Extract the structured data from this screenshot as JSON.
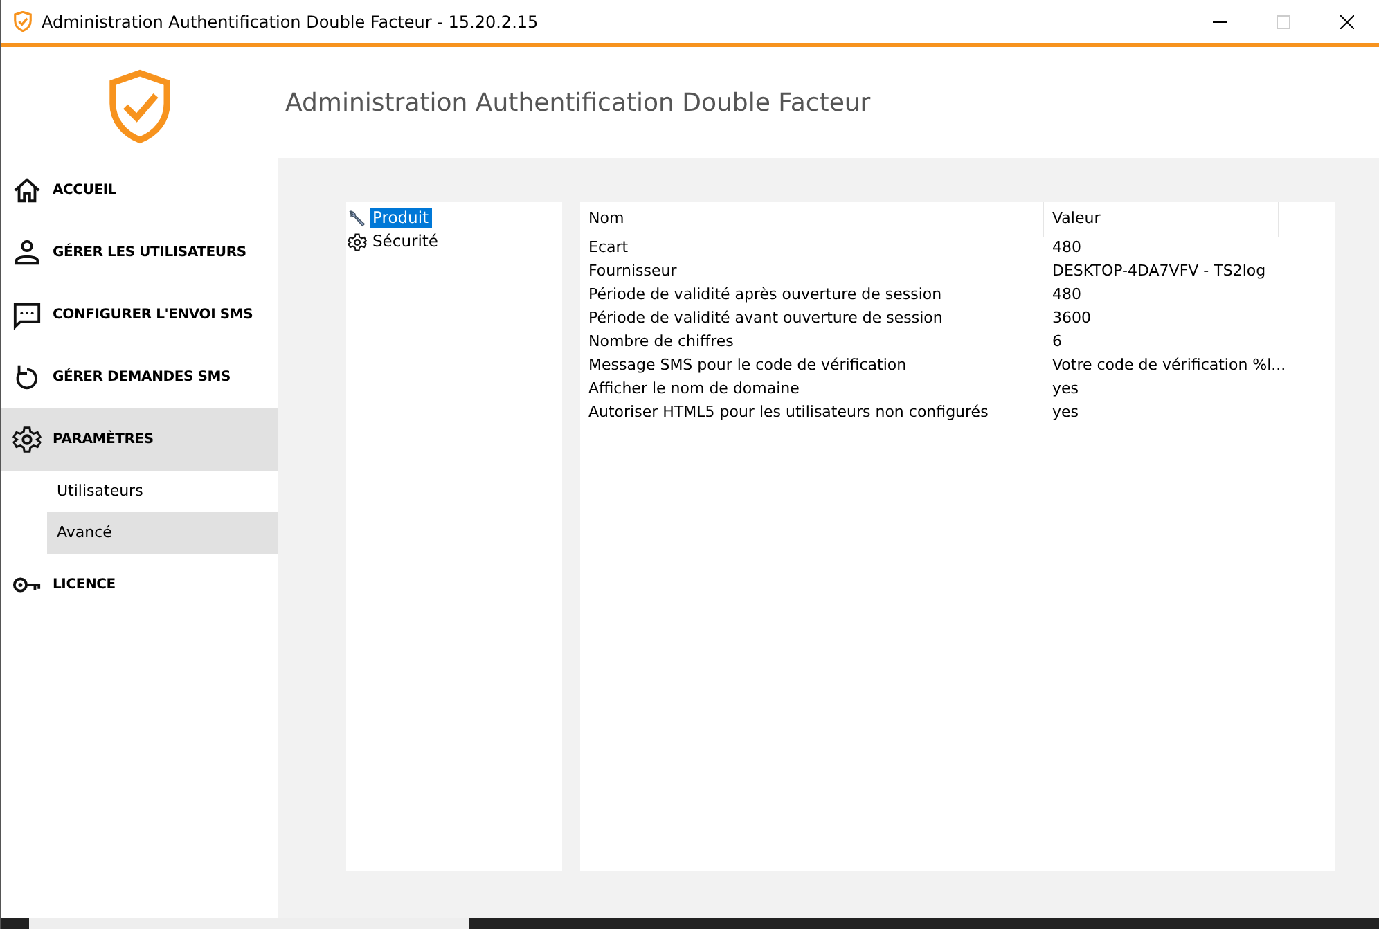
{
  "window": {
    "title": "Administration Authentification Double Facteur - 15.20.2.15"
  },
  "header": {
    "title": "Administration Authentification Double Facteur"
  },
  "sidebar": {
    "items": [
      {
        "label": "ACCUEIL",
        "kind": "main",
        "selected": false
      },
      {
        "label": "GÉRER LES UTILISATEURS",
        "kind": "main",
        "selected": false
      },
      {
        "label": "CONFIGURER L'ENVOI SMS",
        "kind": "main",
        "selected": false
      },
      {
        "label": "GÉRER DEMANDES SMS",
        "kind": "main",
        "selected": false
      },
      {
        "label": "PARAMÈTRES",
        "kind": "main",
        "selected": true
      },
      {
        "label": "Utilisateurs",
        "kind": "sub",
        "selected": false
      },
      {
        "label": "Avancé",
        "kind": "sub",
        "selected": true
      },
      {
        "label": "LICENCE",
        "kind": "main",
        "selected": false
      }
    ]
  },
  "tree": {
    "items": [
      {
        "label": "Produit",
        "selected": true
      },
      {
        "label": "Sécurité",
        "selected": false
      }
    ]
  },
  "table": {
    "columns": [
      "Nom",
      "Valeur"
    ],
    "rows": [
      [
        "Ecart",
        "480"
      ],
      [
        "Fournisseur",
        "DESKTOP-4DA7VFV - TS2log"
      ],
      [
        "Période de validité après ouverture de session",
        "480"
      ],
      [
        "Période de validité avant ouverture de session",
        "3600"
      ],
      [
        "Nombre de chiffres",
        "6"
      ],
      [
        "Message SMS pour le code de vérification",
        "Votre code de vérification %l..."
      ],
      [
        "Afficher le nom de domaine",
        "yes"
      ],
      [
        "Autoriser HTML5 pour les utilisateurs non configurés",
        "yes"
      ]
    ]
  }
}
